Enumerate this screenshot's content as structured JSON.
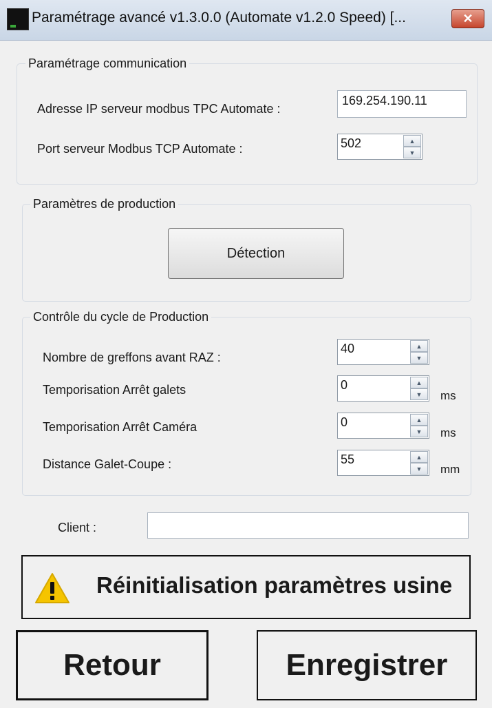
{
  "window": {
    "title": "Paramétrage avancé v1.3.0.0 (Automate v1.2.0 Speed) [...",
    "close_glyph": "✕"
  },
  "communication": {
    "legend": "Paramétrage communication",
    "ip_label": "Adresse IP serveur modbus TPC Automate :",
    "ip_value": "169.254.190.11",
    "port_label": "Port serveur Modbus TCP Automate :",
    "port_value": "502"
  },
  "production": {
    "legend": "Paramètres de production",
    "detection_button": "Détection"
  },
  "cycle": {
    "legend": "Contrôle du cycle de Production",
    "rows": [
      {
        "label": "Nombre de greffons avant RAZ :",
        "value": "40",
        "unit": ""
      },
      {
        "label": "Temporisation Arrêt galets",
        "value": "0",
        "unit": "ms"
      },
      {
        "label": "Temporisation Arrêt Caméra",
        "value": "0",
        "unit": "ms"
      },
      {
        "label": "Distance Galet-Coupe :",
        "value": "55",
        "unit": "mm"
      }
    ]
  },
  "client": {
    "label": "Client :",
    "value": ""
  },
  "reset": {
    "label": "Réinitialisation paramètres usine",
    "icon": "warning-icon"
  },
  "footer": {
    "back_button": "Retour",
    "save_button": "Enregistrer"
  },
  "colors": {
    "warning_yellow": "#f5c400",
    "close_red": "#c6452d"
  }
}
